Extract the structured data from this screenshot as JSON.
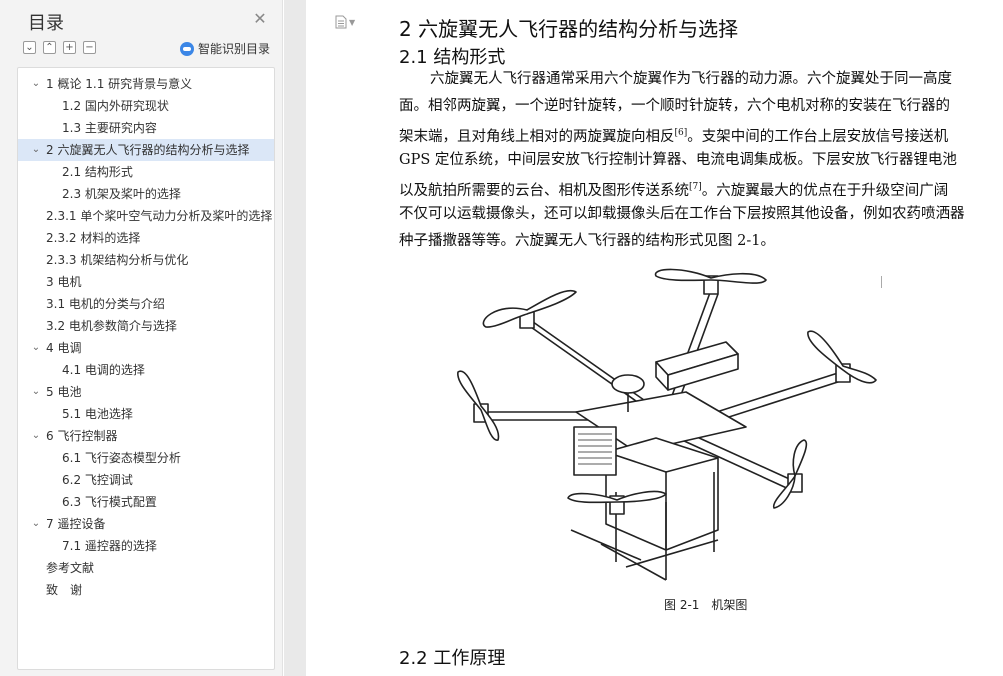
{
  "sidebar": {
    "title": "目录",
    "smart_toc_label": "智能识别目录",
    "items": [
      {
        "label": "1  概论 1.1  研究背景与意义",
        "level": 0,
        "expandable": true,
        "selected": false
      },
      {
        "label": "1.2  国内外研究现状",
        "level": 1,
        "expandable": false,
        "selected": false
      },
      {
        "label": "1.3  主要研究内容",
        "level": 1,
        "expandable": false,
        "selected": false
      },
      {
        "label": "2 六旋翼无人飞行器的结构分析与选择",
        "level": 0,
        "expandable": true,
        "selected": true
      },
      {
        "label": "2.1 结构形式",
        "level": 1,
        "expandable": false,
        "selected": false
      },
      {
        "label": "2.3 机架及桨叶的选择",
        "level": 1,
        "expandable": false,
        "selected": false
      },
      {
        "label": "2.3.1  单个桨叶空气动力分析及桨叶的选择",
        "level": 2,
        "expandable": false,
        "selected": false
      },
      {
        "label": "2.3.2 材料的选择",
        "level": 2,
        "expandable": false,
        "selected": false
      },
      {
        "label": "2.3.3 机架结构分析与优化",
        "level": 2,
        "expandable": false,
        "selected": false
      },
      {
        "label": "3 电机",
        "level": 2,
        "expandable": false,
        "selected": false
      },
      {
        "label": "3.1 电机的分类与介绍",
        "level": 2,
        "expandable": false,
        "selected": false
      },
      {
        "label": "3.2 电机参数简介与选择",
        "level": 2,
        "expandable": false,
        "selected": false
      },
      {
        "label": "4 电调",
        "level": 0,
        "expandable": true,
        "selected": false
      },
      {
        "label": "4.1 电调的选择",
        "level": 1,
        "expandable": false,
        "selected": false
      },
      {
        "label": "5 电池",
        "level": 0,
        "expandable": true,
        "selected": false
      },
      {
        "label": "5.1 电池选择",
        "level": 1,
        "expandable": false,
        "selected": false
      },
      {
        "label": "6 飞行控制器",
        "level": 0,
        "expandable": true,
        "selected": false
      },
      {
        "label": "6.1 飞行姿态模型分析",
        "level": 1,
        "expandable": false,
        "selected": false
      },
      {
        "label": "6.2 飞控调试",
        "level": 1,
        "expandable": false,
        "selected": false
      },
      {
        "label": "6.3 飞行模式配置",
        "level": 1,
        "expandable": false,
        "selected": false
      },
      {
        "label": "7 遥控设备",
        "level": 0,
        "expandable": true,
        "selected": false
      },
      {
        "label": "7.1 遥控器的选择",
        "level": 1,
        "expandable": false,
        "selected": false
      },
      {
        "label": "参考文献",
        "level": 2,
        "expandable": false,
        "selected": false
      },
      {
        "label": "致　谢",
        "level": 2,
        "expandable": false,
        "selected": false
      }
    ]
  },
  "document": {
    "heading1": "2 六旋翼无人飞行器的结构分析与选择",
    "heading2": "2.1 结构形式",
    "paragraph_lines": [
      {
        "text": "六旋翼无人飞行器通常采用六个旋翼作为飞行器的动力源。六个旋翼处于同一高度",
        "sup": "",
        "after": "",
        "indent": true
      },
      {
        "text": "面。相邻两旋翼，一个逆时针旋转，一个顺时针旋转，六个电机对称的安装在飞行器的",
        "sup": "",
        "after": "",
        "indent": false
      },
      {
        "text": "架末端，且对角线上相对的两旋翼旋向相反",
        "sup": "[6]",
        "after": "。支架中间的工作台上层安放信号接送机",
        "indent": false
      },
      {
        "text": "GPS 定位系统，中间层安放飞行控制计算器、电流电调集成板。下层安放飞行器锂电池",
        "sup": "",
        "after": "",
        "indent": false
      },
      {
        "text": "以及航拍所需要的云台、相机及图形传送系统",
        "sup": "[7]",
        "after": "。六旋翼最大的优点在于升级空间广阔",
        "indent": false
      },
      {
        "text": "不仅可以运载摄像头，还可以卸载摄像头后在工作台下层按照其他设备，例如农药喷洒器",
        "sup": "",
        "after": "",
        "indent": false
      },
      {
        "text": "种子播撒器等等。六旋翼无人飞行器的结构形式见图 2-1。",
        "sup": "",
        "after": "",
        "indent": false
      }
    ],
    "figure_caption": "图 2-1　机架图",
    "next_heading": "2.2 工作原理"
  }
}
